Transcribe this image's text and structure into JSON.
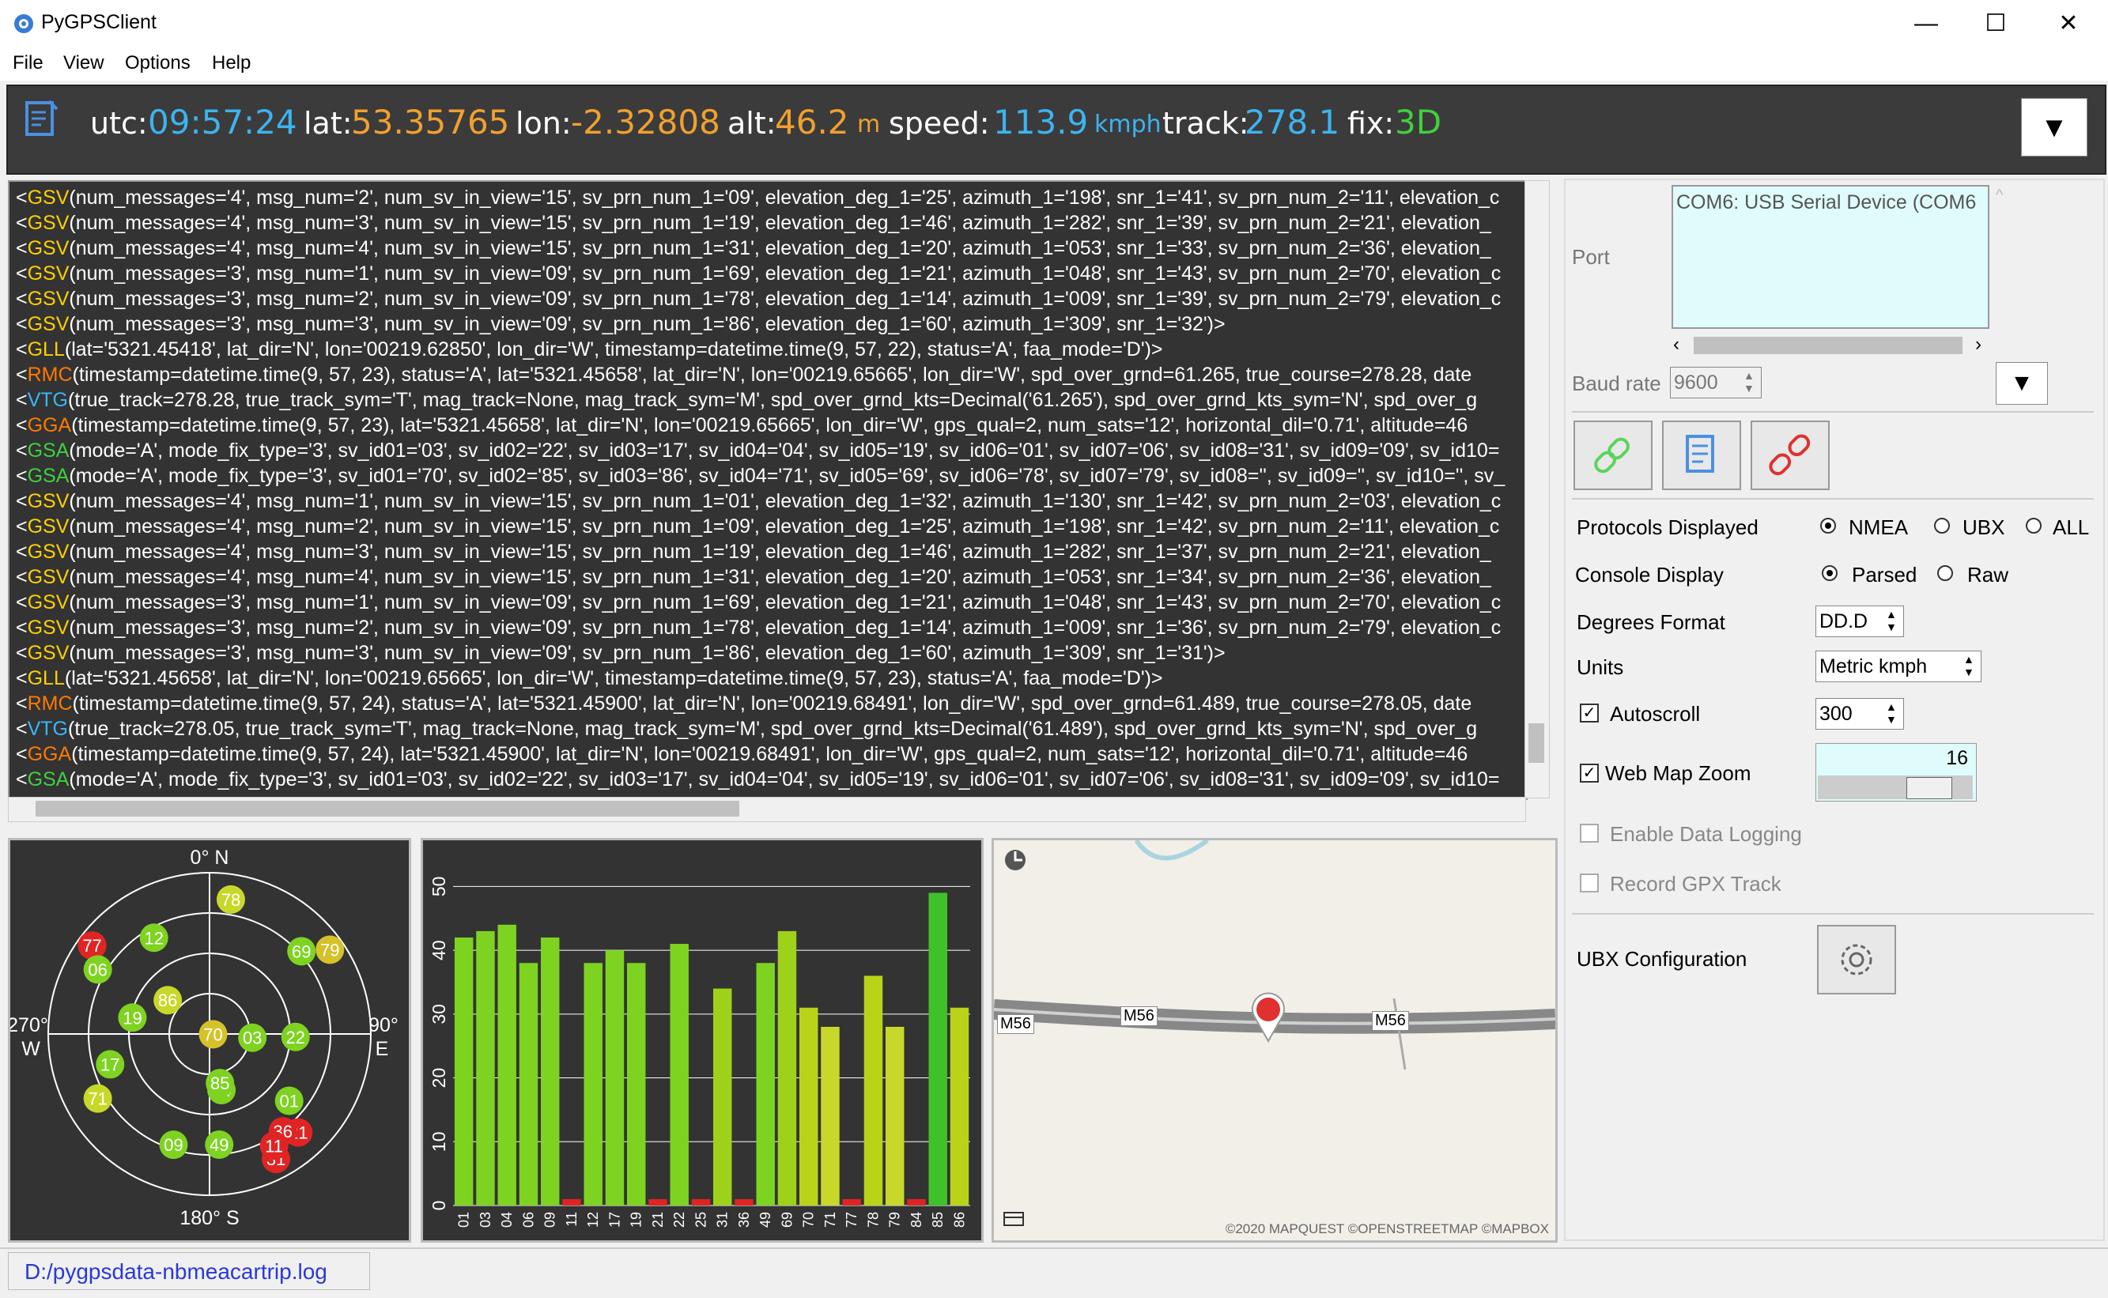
{
  "window": {
    "title": "PyGPSClient",
    "minimize": "—",
    "maximize": "☐",
    "close": "✕"
  },
  "menu": [
    {
      "label": "File"
    },
    {
      "label": "View"
    },
    {
      "label": "Options"
    },
    {
      "label": "Help"
    }
  ],
  "banner": {
    "utc_label": "utc:",
    "utc": "09:57:24",
    "lat_label": "lat:",
    "lat": "53.35765",
    "lon_label": "lon:",
    "lon": "-2.32808",
    "alt_label": "alt:",
    "alt": "46.2",
    "alt_unit": "m",
    "speed_label": "speed:",
    "speed": "113.9",
    "speed_unit": "kmph",
    "track_label": "track:",
    "track": "278.1",
    "fix_label": "fix:",
    "fix": "3D",
    "toggle": "▼"
  },
  "console": {
    "lines": [
      {
        "tag": "GSV",
        "color": "#ffd000",
        "text": "(num_messages='4', msg_num='2', num_sv_in_view='15', sv_prn_num_1='09', elevation_deg_1='25', azimuth_1='198', snr_1='41', sv_prn_num_2='11', elevation_c"
      },
      {
        "tag": "GSV",
        "color": "#ffd000",
        "text": "(num_messages='4', msg_num='3', num_sv_in_view='15', sv_prn_num_1='19', elevation_deg_1='46', azimuth_1='282', snr_1='39', sv_prn_num_2='21', elevation_"
      },
      {
        "tag": "GSV",
        "color": "#ffd000",
        "text": "(num_messages='4', msg_num='4', num_sv_in_view='15', sv_prn_num_1='31', elevation_deg_1='20', azimuth_1='053', snr_1='33', sv_prn_num_2='36', elevation_"
      },
      {
        "tag": "GSV",
        "color": "#ffd000",
        "text": "(num_messages='3', msg_num='1', num_sv_in_view='09', sv_prn_num_1='69', elevation_deg_1='21', azimuth_1='048', snr_1='43', sv_prn_num_2='70', elevation_c"
      },
      {
        "tag": "GSV",
        "color": "#ffd000",
        "text": "(num_messages='3', msg_num='2', num_sv_in_view='09', sv_prn_num_1='78', elevation_deg_1='14', azimuth_1='009', snr_1='39', sv_prn_num_2='79', elevation_c"
      },
      {
        "tag": "GSV",
        "color": "#ffd000",
        "text": "(num_messages='3', msg_num='3', num_sv_in_view='09', sv_prn_num_1='86', elevation_deg_1='60', azimuth_1='309', snr_1='32')>"
      },
      {
        "tag": "GLL",
        "color": "#ffd000",
        "text": "(lat='5321.45418', lat_dir='N', lon='00219.62850', lon_dir='W', timestamp=datetime.time(9, 57, 22), status='A', faa_mode='D')>"
      },
      {
        "tag": "RMC",
        "color": "#ff7a00",
        "text": "(timestamp=datetime.time(9, 57, 23), status='A', lat='5321.45658', lat_dir='N', lon='00219.65665', lon_dir='W', spd_over_grnd=61.265, true_course=278.28, date"
      },
      {
        "tag": "VTG",
        "color": "#39b7ff",
        "text": "(true_track=278.28, true_track_sym='T', mag_track=None, mag_track_sym='M', spd_over_grnd_kts=Decimal('61.265'), spd_over_grnd_kts_sym='N', spd_over_g"
      },
      {
        "tag": "GGA",
        "color": "#ff7a00",
        "text": "(timestamp=datetime.time(9, 57, 23), lat='5321.45658', lat_dir='N', lon='00219.65665', lon_dir='W', gps_qual=2, num_sats='12', horizontal_dil='0.71', altitude=46"
      },
      {
        "tag": "GSA",
        "color": "#3fd13f",
        "text": "(mode='A', mode_fix_type='3', sv_id01='03', sv_id02='22', sv_id03='17', sv_id04='04', sv_id05='19', sv_id06='01', sv_id07='06', sv_id08='31', sv_id09='09', sv_id10="
      },
      {
        "tag": "GSA",
        "color": "#3fd13f",
        "text": "(mode='A', mode_fix_type='3', sv_id01='70', sv_id02='85', sv_id03='86', sv_id04='71', sv_id05='69', sv_id06='78', sv_id07='79', sv_id08='', sv_id09='', sv_id10='', sv_"
      },
      {
        "tag": "GSV",
        "color": "#ffd000",
        "text": "(num_messages='4', msg_num='1', num_sv_in_view='15', sv_prn_num_1='01', elevation_deg_1='32', azimuth_1='130', snr_1='42', sv_prn_num_2='03', elevation_c"
      },
      {
        "tag": "GSV",
        "color": "#ffd000",
        "text": "(num_messages='4', msg_num='2', num_sv_in_view='15', sv_prn_num_1='09', elevation_deg_1='25', azimuth_1='198', snr_1='42', sv_prn_num_2='11', elevation_c"
      },
      {
        "tag": "GSV",
        "color": "#ffd000",
        "text": "(num_messages='4', msg_num='3', num_sv_in_view='15', sv_prn_num_1='19', elevation_deg_1='46', azimuth_1='282', snr_1='37', sv_prn_num_2='21', elevation_"
      },
      {
        "tag": "GSV",
        "color": "#ffd000",
        "text": "(num_messages='4', msg_num='4', num_sv_in_view='15', sv_prn_num_1='31', elevation_deg_1='20', azimuth_1='053', snr_1='34', sv_prn_num_2='36', elevation_"
      },
      {
        "tag": "GSV",
        "color": "#ffd000",
        "text": "(num_messages='3', msg_num='1', num_sv_in_view='09', sv_prn_num_1='69', elevation_deg_1='21', azimuth_1='048', snr_1='43', sv_prn_num_2='70', elevation_c"
      },
      {
        "tag": "GSV",
        "color": "#ffd000",
        "text": "(num_messages='3', msg_num='2', num_sv_in_view='09', sv_prn_num_1='78', elevation_deg_1='14', azimuth_1='009', snr_1='36', sv_prn_num_2='79', elevation_c"
      },
      {
        "tag": "GSV",
        "color": "#ffd000",
        "text": "(num_messages='3', msg_num='3', num_sv_in_view='09', sv_prn_num_1='86', elevation_deg_1='60', azimuth_1='309', snr_1='31')>"
      },
      {
        "tag": "GLL",
        "color": "#ffd000",
        "text": "(lat='5321.45658', lat_dir='N', lon='00219.65665', lon_dir='W', timestamp=datetime.time(9, 57, 23), status='A', faa_mode='D')>"
      },
      {
        "tag": "RMC",
        "color": "#ff7a00",
        "text": "(timestamp=datetime.time(9, 57, 24), status='A', lat='5321.45900', lat_dir='N', lon='00219.68491', lon_dir='W', spd_over_grnd=61.489, true_course=278.05, date"
      },
      {
        "tag": "VTG",
        "color": "#39b7ff",
        "text": "(true_track=278.05, true_track_sym='T', mag_track=None, mag_track_sym='M', spd_over_grnd_kts=Decimal('61.489'), spd_over_grnd_kts_sym='N', spd_over_g"
      },
      {
        "tag": "GGA",
        "color": "#ff7a00",
        "text": "(timestamp=datetime.time(9, 57, 24), lat='5321.45900', lat_dir='N', lon='00219.68491', lon_dir='W', gps_qual=2, num_sats='12', horizontal_dil='0.71', altitude=46"
      },
      {
        "tag": "GSA",
        "color": "#3fd13f",
        "text": "(mode='A', mode_fix_type='3', sv_id01='03', sv_id02='22', sv_id03='17', sv_id04='04', sv_id05='19', sv_id06='01', sv_id07='06', sv_id08='31', sv_id09='09', sv_id10="
      }
    ]
  },
  "skyview": {
    "n_label": "0° N",
    "s_label": "180° S",
    "w_deg": "270°",
    "w_label": "W",
    "e_deg": "90°",
    "e_label": "E",
    "satellites": [
      {
        "id": "12",
        "az": 330,
        "el": 28,
        "color": "#7ed321"
      },
      {
        "id": "77",
        "az": 307,
        "el": 8,
        "color": "#e02424"
      },
      {
        "id": "78",
        "az": 9,
        "el": 14,
        "color": "#c8d82a"
      },
      {
        "id": "69",
        "az": 48,
        "el": 21,
        "color": "#7ed321"
      },
      {
        "id": "79",
        "az": 55,
        "el": 8,
        "color": "#d5c22a"
      },
      {
        "id": "06",
        "az": 300,
        "el": 18,
        "color": "#7ed321"
      },
      {
        "id": "86",
        "az": 309,
        "el": 60,
        "color": "#c8d82a"
      },
      {
        "id": "19",
        "az": 282,
        "el": 46,
        "color": "#7ed321"
      },
      {
        "id": "70",
        "az": 95,
        "el": 88,
        "color": "#d5c22a"
      },
      {
        "id": "03",
        "az": 95,
        "el": 66,
        "color": "#7ed321"
      },
      {
        "id": "22",
        "az": 92,
        "el": 42,
        "color": "#7ed321"
      },
      {
        "id": "17",
        "az": 253,
        "el": 32,
        "color": "#7ed321"
      },
      {
        "id": "71",
        "az": 240,
        "el": 18,
        "color": "#c8d82a"
      },
      {
        "id": "04",
        "az": 168,
        "el": 58,
        "color": "#7ed321"
      },
      {
        "id": "85",
        "az": 168,
        "el": 62,
        "color": "#7ed321"
      },
      {
        "id": "01",
        "az": 130,
        "el": 32,
        "color": "#7ed321"
      },
      {
        "id": "21",
        "az": 138,
        "el": 16,
        "color": "#e02424"
      },
      {
        "id": "36",
        "az": 143,
        "el": 22,
        "color": "#e02424"
      },
      {
        "id": "31",
        "az": 152,
        "el": 11,
        "color": "#e02424"
      },
      {
        "id": "11",
        "az": 150,
        "el": 18,
        "color": "#e02424"
      },
      {
        "id": "09",
        "az": 198,
        "el": 25,
        "color": "#7ed321"
      },
      {
        "id": "49",
        "az": 175,
        "el": 28,
        "color": "#7ed321"
      }
    ]
  },
  "chart_data": {
    "type": "bar",
    "categories": [
      "01",
      "03",
      "04",
      "06",
      "09",
      "11",
      "12",
      "17",
      "19",
      "21",
      "22",
      "25",
      "31",
      "36",
      "49",
      "69",
      "70",
      "71",
      "77",
      "78",
      "79",
      "84",
      "85",
      "86"
    ],
    "values": [
      42,
      43,
      44,
      38,
      42,
      1,
      38,
      40,
      38,
      1,
      41,
      1,
      34,
      1,
      38,
      43,
      31,
      28,
      1,
      36,
      28,
      1,
      49,
      31
    ],
    "colors": [
      "#7ed321",
      "#7ed321",
      "#7ed321",
      "#7ed321",
      "#7ed321",
      "#e02424",
      "#7ed321",
      "#7ed321",
      "#7ed321",
      "#e02424",
      "#7ed321",
      "#e02424",
      "#9ed11a",
      "#e02424",
      "#7ed321",
      "#9ed11a",
      "#b9d418",
      "#c8d82a",
      "#e02424",
      "#b9d418",
      "#c8d82a",
      "#e02424",
      "#3fc12a",
      "#b9d418"
    ],
    "ylim": [
      0,
      55
    ],
    "yticks": [
      "0",
      "10",
      "20",
      "30",
      "40",
      "50"
    ]
  },
  "map": {
    "road_labels": [
      "M56",
      "M56",
      "M56"
    ],
    "attribution": "©2020 MAPQUEST ©OPENSTREETMAP ©MAPBOX"
  },
  "settings": {
    "port_label": "Port",
    "port_value": "COM6: USB Serial Device (COM6",
    "baud_label": "Baud rate",
    "baud_value": "9600",
    "protocols_label": "Protocols Displayed",
    "protocols": [
      {
        "label": "NMEA",
        "selected": true
      },
      {
        "label": "UBX",
        "selected": false
      },
      {
        "label": "ALL",
        "selected": false
      }
    ],
    "console_display_label": "Console Display",
    "console_display": [
      {
        "label": "Parsed",
        "selected": true
      },
      {
        "label": "Raw",
        "selected": false
      }
    ],
    "degrees_label": "Degrees Format",
    "degrees_value": "DD.D",
    "units_label": "Units",
    "units_value": "Metric kmph",
    "autoscroll_label": "Autoscroll",
    "autoscroll_value": "300",
    "webmap_label": "Web Map  Zoom",
    "webmap_zoom": "16",
    "zoom_fraction": 0.8,
    "datalog_label": "Enable Data Logging",
    "gpx_label": "Record GPX Track",
    "ubx_label": "UBX Configuration"
  },
  "status": {
    "logfile": "D:/pygpsdata-nbmeacartrip.log"
  }
}
